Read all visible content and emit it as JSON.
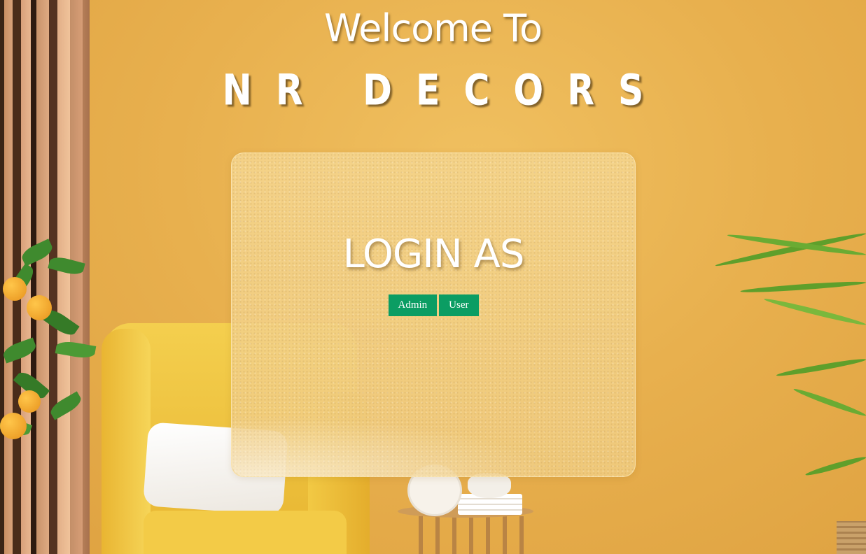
{
  "header": {
    "welcome": "Welcome To",
    "brand": "NR DECORS"
  },
  "login": {
    "title": "LOGIN AS",
    "buttons": [
      {
        "label": "Admin"
      },
      {
        "label": "User"
      }
    ]
  },
  "colors": {
    "background": "#e8b04e",
    "button": "#0b9d63",
    "text": "#ffffff"
  }
}
